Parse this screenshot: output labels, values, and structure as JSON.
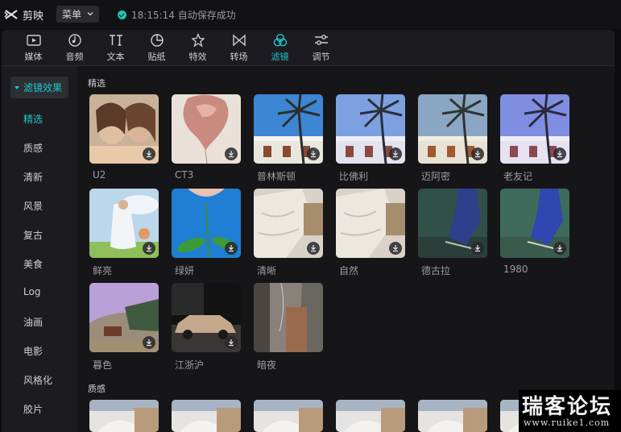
{
  "app": {
    "name": "剪映",
    "menu_label": "菜单",
    "save_status": "18:15:14 自动保存成功"
  },
  "toolbar": {
    "items": [
      {
        "label": "媒体",
        "icon": "media-icon"
      },
      {
        "label": "音频",
        "icon": "audio-icon"
      },
      {
        "label": "文本",
        "icon": "text-icon"
      },
      {
        "label": "贴纸",
        "icon": "sticker-icon"
      },
      {
        "label": "特效",
        "icon": "effects-icon"
      },
      {
        "label": "转场",
        "icon": "transition-icon"
      },
      {
        "label": "滤镜",
        "icon": "filter-icon",
        "active": true
      },
      {
        "label": "调节",
        "icon": "adjust-icon"
      }
    ]
  },
  "sidebar": {
    "header": "滤镜效果",
    "items": [
      "精选",
      "质感",
      "清新",
      "风景",
      "复古",
      "美食",
      "Log",
      "油画",
      "电影",
      "风格化",
      "胶片"
    ],
    "active_index": 0
  },
  "content": {
    "section_featured": "精选",
    "section_texture": "质感",
    "filters": [
      {
        "label": "U2",
        "style": "women"
      },
      {
        "label": "CT3",
        "style": "balloon"
      },
      {
        "label": "普林斯顿",
        "style": "palm"
      },
      {
        "label": "比佛利",
        "style": "palm-cool"
      },
      {
        "label": "迈阿密",
        "style": "palm-warm"
      },
      {
        "label": "老友记",
        "style": "palm-violet"
      },
      {
        "label": "鲜亮",
        "style": "girl-field"
      },
      {
        "label": "绿妍",
        "style": "flower"
      },
      {
        "label": "清晰",
        "style": "cloth"
      },
      {
        "label": "自然",
        "style": "cloth"
      },
      {
        "label": "德古拉",
        "style": "runner-dark"
      },
      {
        "label": "1980",
        "style": "runner"
      },
      {
        "label": "暮色",
        "style": "dusk"
      },
      {
        "label": "江浙沪",
        "style": "car"
      },
      {
        "label": "暗夜",
        "style": "dark-room"
      }
    ]
  },
  "watermark": {
    "main": "瑞客论坛",
    "sub": "www.ruike1.com"
  },
  "colors": {
    "accent": "#1ec6c9",
    "panel": "#1c1c20",
    "content_bg": "#161619"
  }
}
